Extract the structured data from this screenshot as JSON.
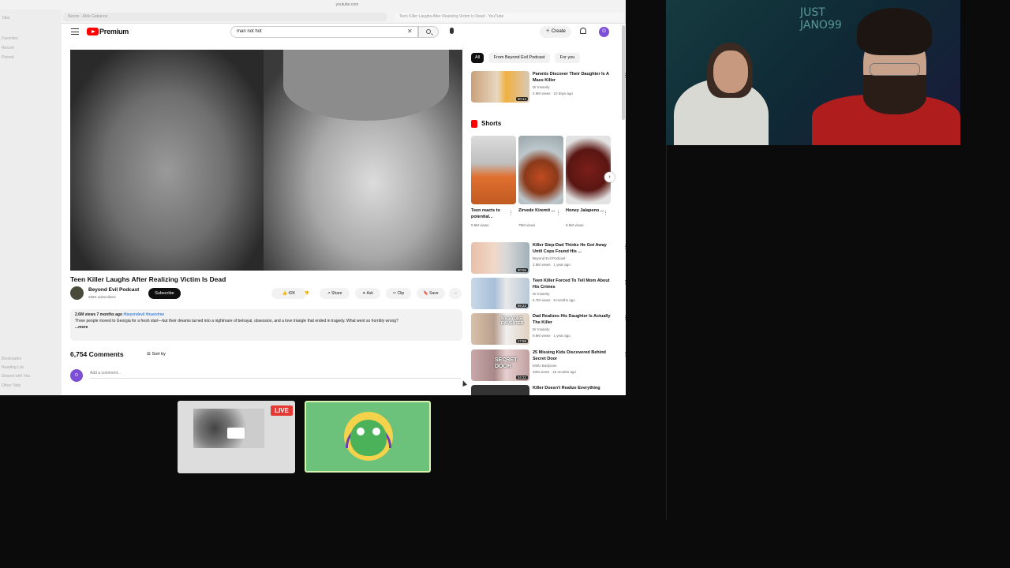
{
  "browser": {
    "url": "youtube.com",
    "tabs": [
      "Nexon - Aldo Gabanos",
      "Teen Killer Laughs After Realizing Victim Is Dead - YouTube"
    ],
    "sidebar_items": [
      "Tabs",
      "Favorites",
      "Recent",
      "Pinned",
      "Bookmarks",
      "Reading List",
      "Shared with You",
      "Other Tabs"
    ]
  },
  "youtube": {
    "logo_text": "Premium",
    "search_value": "man not hot",
    "create_label": "Create",
    "avatar_letter": "O"
  },
  "video": {
    "title": "Teen Killer Laughs After Realizing Victim Is Dead",
    "channel": "Beyond Evil Podcast",
    "subscribers": "292K subscribers",
    "subscribe_label": "Subscribe",
    "likes": "42K",
    "share_label": "Share",
    "ask_label": "Ask",
    "clip_label": "Clip",
    "save_label": "Save",
    "more_label": "⋯",
    "desc_meta": "2.6M views  7 months ago",
    "desc_tags": "#beyondevil #truecrime",
    "desc_text": "Three people moved to Georgia for a fresh start—but their dreams turned into a nightmare of betrayal, obsession, and a love triangle that ended in tragedy. What went so horribly wrong?",
    "desc_more": "...more"
  },
  "comments": {
    "count": "6,754 Comments",
    "sort_label": "Sort by",
    "add_placeholder": "Add a comment..."
  },
  "chips": [
    "All",
    "From Beyond Evil Podcast",
    "For you"
  ],
  "recommended_top": {
    "title": "Parents Discover Their Daughter Is A Mass Killer",
    "channel": "Dr Insanity",
    "meta": "2.9M views · 10 days ago",
    "duration": "30:14"
  },
  "shorts": {
    "heading": "Shorts",
    "items": [
      {
        "title": "Teen reacts to potential...",
        "views": "5.9M views"
      },
      {
        "title": "Zirvede Kiremit ...",
        "views": "75M views"
      },
      {
        "title": "Honey Jalapeno ...",
        "views": "9.5M views"
      }
    ]
  },
  "recommended": [
    {
      "title": "Killer Step-Dad Thinks He Got Away Until Cops Found His ...",
      "channel": "Beyond Evil Podcast",
      "meta": "2.8M views · 1 year ago",
      "duration": "30:55"
    },
    {
      "title": "Teen Killer Forced To Tell Mom About His Crimes",
      "channel": "Dr Insanity",
      "meta": "5.7M views · 8 months ago",
      "duration": "09:23"
    },
    {
      "title": "Dad Realizes His Daughter Is Actually The Killer",
      "channel": "Dr Insanity",
      "meta": "9.9M views · 1 year ago",
      "duration": "17:58"
    },
    {
      "title": "25 Missing Kids Discovered Behind Secret Door",
      "channel": "EWU Bodycam",
      "meta": "20M views · 10 months ago",
      "duration": "34:22"
    },
    {
      "title": "Killer Doesn't Realize Everything",
      "channel": "",
      "meta": "",
      "duration": ""
    }
  ],
  "thumb_texts": [
    "SECRET DOOR",
    "WAS YOUR DAUGHTER"
  ],
  "webcam": {
    "sign_text": "JUST JANO99"
  },
  "overlay": {
    "live_label": "LIVE"
  },
  "colors": {
    "youtube_red": "#ff0000",
    "live_red": "#e53935",
    "avatar_purple": "#7b4fd6",
    "avatar_bg": "#6cc27a"
  }
}
